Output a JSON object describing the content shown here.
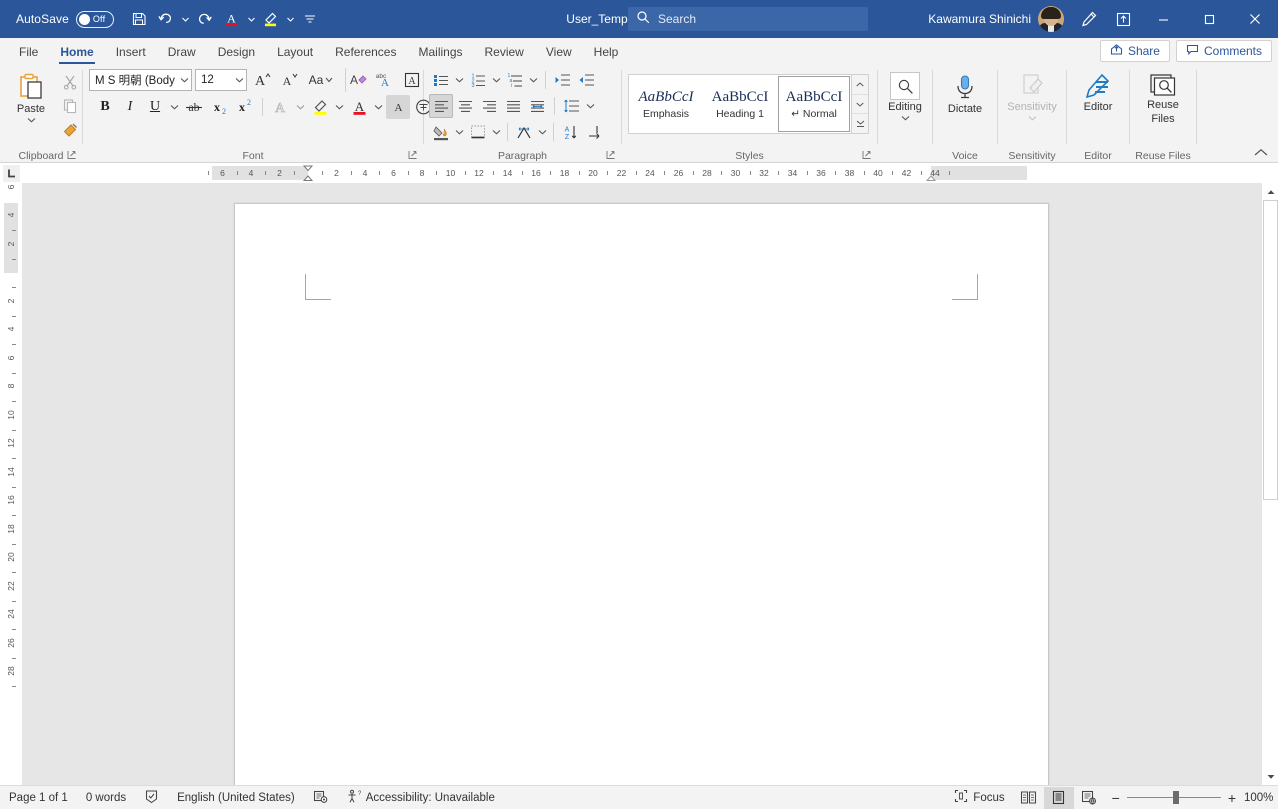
{
  "titlebar": {
    "autosave_label": "AutoSave",
    "autosave_state": "Off",
    "document_title": "User_Template.docx",
    "document_title_suffix": "-...",
    "quick_access": [
      {
        "name": "save-button",
        "tooltip": "Save"
      },
      {
        "name": "undo-button",
        "tooltip": "Undo"
      },
      {
        "name": "redo-button",
        "tooltip": "Redo"
      },
      {
        "name": "font-color-button",
        "tooltip": "Font Color"
      },
      {
        "name": "highlight-button",
        "tooltip": "Text Highlight Color"
      },
      {
        "name": "customize-qat-button",
        "tooltip": "Customize Quick Access Toolbar"
      }
    ],
    "search_placeholder": "Search",
    "account_name": "Kawamura Shinichi",
    "window_controls": {
      "minimize": "–",
      "maximize": "□",
      "close": "✕"
    }
  },
  "tabs": [
    {
      "label": "File",
      "active": false
    },
    {
      "label": "Home",
      "active": true
    },
    {
      "label": "Insert",
      "active": false
    },
    {
      "label": "Draw",
      "active": false
    },
    {
      "label": "Design",
      "active": false
    },
    {
      "label": "Layout",
      "active": false
    },
    {
      "label": "References",
      "active": false
    },
    {
      "label": "Mailings",
      "active": false
    },
    {
      "label": "Review",
      "active": false
    },
    {
      "label": "View",
      "active": false
    },
    {
      "label": "Help",
      "active": false
    }
  ],
  "tabstrip_buttons": {
    "share_label": "Share",
    "comments_label": "Comments"
  },
  "ribbon": {
    "groups": [
      {
        "name": "clipboard",
        "label": "Clipboard"
      },
      {
        "name": "font",
        "label": "Font"
      },
      {
        "name": "paragraph",
        "label": "Paragraph"
      },
      {
        "name": "styles",
        "label": "Styles"
      },
      {
        "name": "voice",
        "label": "Voice"
      },
      {
        "name": "sensitivity",
        "label": "Sensitivity"
      },
      {
        "name": "editor",
        "label": "Editor"
      },
      {
        "name": "reuse_files",
        "label": "Reuse Files"
      }
    ],
    "clipboard": {
      "paste_label": "Paste",
      "cut_tooltip": "Cut",
      "copy_tooltip": "Copy",
      "format_painter_tooltip": "Format Painter"
    },
    "font": {
      "font_name": "M S 明朝 (Body",
      "font_size": "12",
      "grow_font": "A",
      "shrink_font": "A",
      "change_case": "Aa",
      "clear_formatting_tooltip": "Clear All Formatting",
      "phonetic_guide_tooltip": "Phonetic Guide",
      "character_border_tooltip": "Character Border",
      "bold": "B",
      "italic": "I",
      "underline": "U",
      "strikethrough_tooltip": "Strikethrough",
      "subscript": "x",
      "subscript_sup": "2",
      "superscript": "x",
      "superscript_sup": "2",
      "text_effects_tooltip": "Text Effects and Typography",
      "highlight_tooltip": "Text Highlight Color",
      "font_color_tooltip": "Font Color",
      "character_shading_tooltip": "Character Shading",
      "enclose_characters_tooltip": "Enclose Characters"
    },
    "paragraph": {
      "bullets_tooltip": "Bullets",
      "numbering_tooltip": "Numbering",
      "multilevel_tooltip": "Multilevel List",
      "decrease_indent_tooltip": "Decrease Indent",
      "increase_indent_tooltip": "Increase Indent",
      "align_left_tooltip": "Align Left",
      "align_center_tooltip": "Center",
      "align_right_tooltip": "Align Right",
      "justify_tooltip": "Justify",
      "distributed_tooltip": "Distributed",
      "line_spacing_tooltip": "Line and Paragraph Spacing",
      "shading_tooltip": "Shading",
      "borders_tooltip": "Borders",
      "asian_layout_tooltip": "Asian Layout",
      "sort_tooltip": "Sort",
      "show_marks_tooltip": "Show/Hide Paragraph Marks"
    },
    "styles": {
      "items": [
        {
          "preview": "AaBbCcI",
          "name": "Emphasis",
          "selected": false,
          "italic": true
        },
        {
          "preview": "AaBbCcI",
          "name": "Heading 1",
          "selected": false,
          "italic": false
        },
        {
          "preview": "AaBbCcI",
          "name": "↵ Normal",
          "selected": true,
          "italic": false
        }
      ]
    },
    "editing": {
      "label": "Editing"
    },
    "voice": {
      "label": "Dictate"
    },
    "sensitivity": {
      "label": "Sensitivity",
      "disabled": true
    },
    "editor": {
      "label": "Editor"
    },
    "reuse_files": {
      "label": "Reuse",
      "label2": "Files"
    },
    "collapse_tooltip": "Collapse the Ribbon"
  },
  "ruler": {
    "tab_selector": "L",
    "horizontal_ticks": [
      "6",
      "4",
      "2",
      "2",
      "4",
      "6",
      "8",
      "10",
      "12",
      "14",
      "16",
      "18",
      "20",
      "22",
      "24",
      "26",
      "28",
      "30",
      "32",
      "34",
      "36",
      "38",
      "40",
      "42",
      "44"
    ],
    "vertical_ticks": [
      "6",
      "4",
      "2",
      "2",
      "4",
      "6",
      "8",
      "10",
      "12",
      "14",
      "16",
      "18",
      "20",
      "22",
      "24",
      "26",
      "28"
    ]
  },
  "document": {
    "content": ""
  },
  "statusbar": {
    "page_info": "Page 1 of 1",
    "word_count": "0 words",
    "proofing_tooltip": "Proofing errors",
    "language": "English (United States)",
    "macro_tooltip": "Macro Recording",
    "accessibility": "Accessibility: Unavailable",
    "focus_label": "Focus",
    "view_read_tooltip": "Read Mode",
    "view_print_tooltip": "Print Layout",
    "view_web_tooltip": "Web Layout",
    "zoom_out": "−",
    "zoom_in": "+",
    "zoom_level": "100%"
  },
  "colors": {
    "titlebar": "#2b579a",
    "accent": "#2b579a",
    "ribbon_bg": "#f3f3f3",
    "canvas_bg": "#e6e6e6",
    "page_bg": "#ffffff",
    "highlight_yellow": "#ffff00",
    "font_red": "#e81123",
    "icon_blue": "#1e7bc8"
  }
}
